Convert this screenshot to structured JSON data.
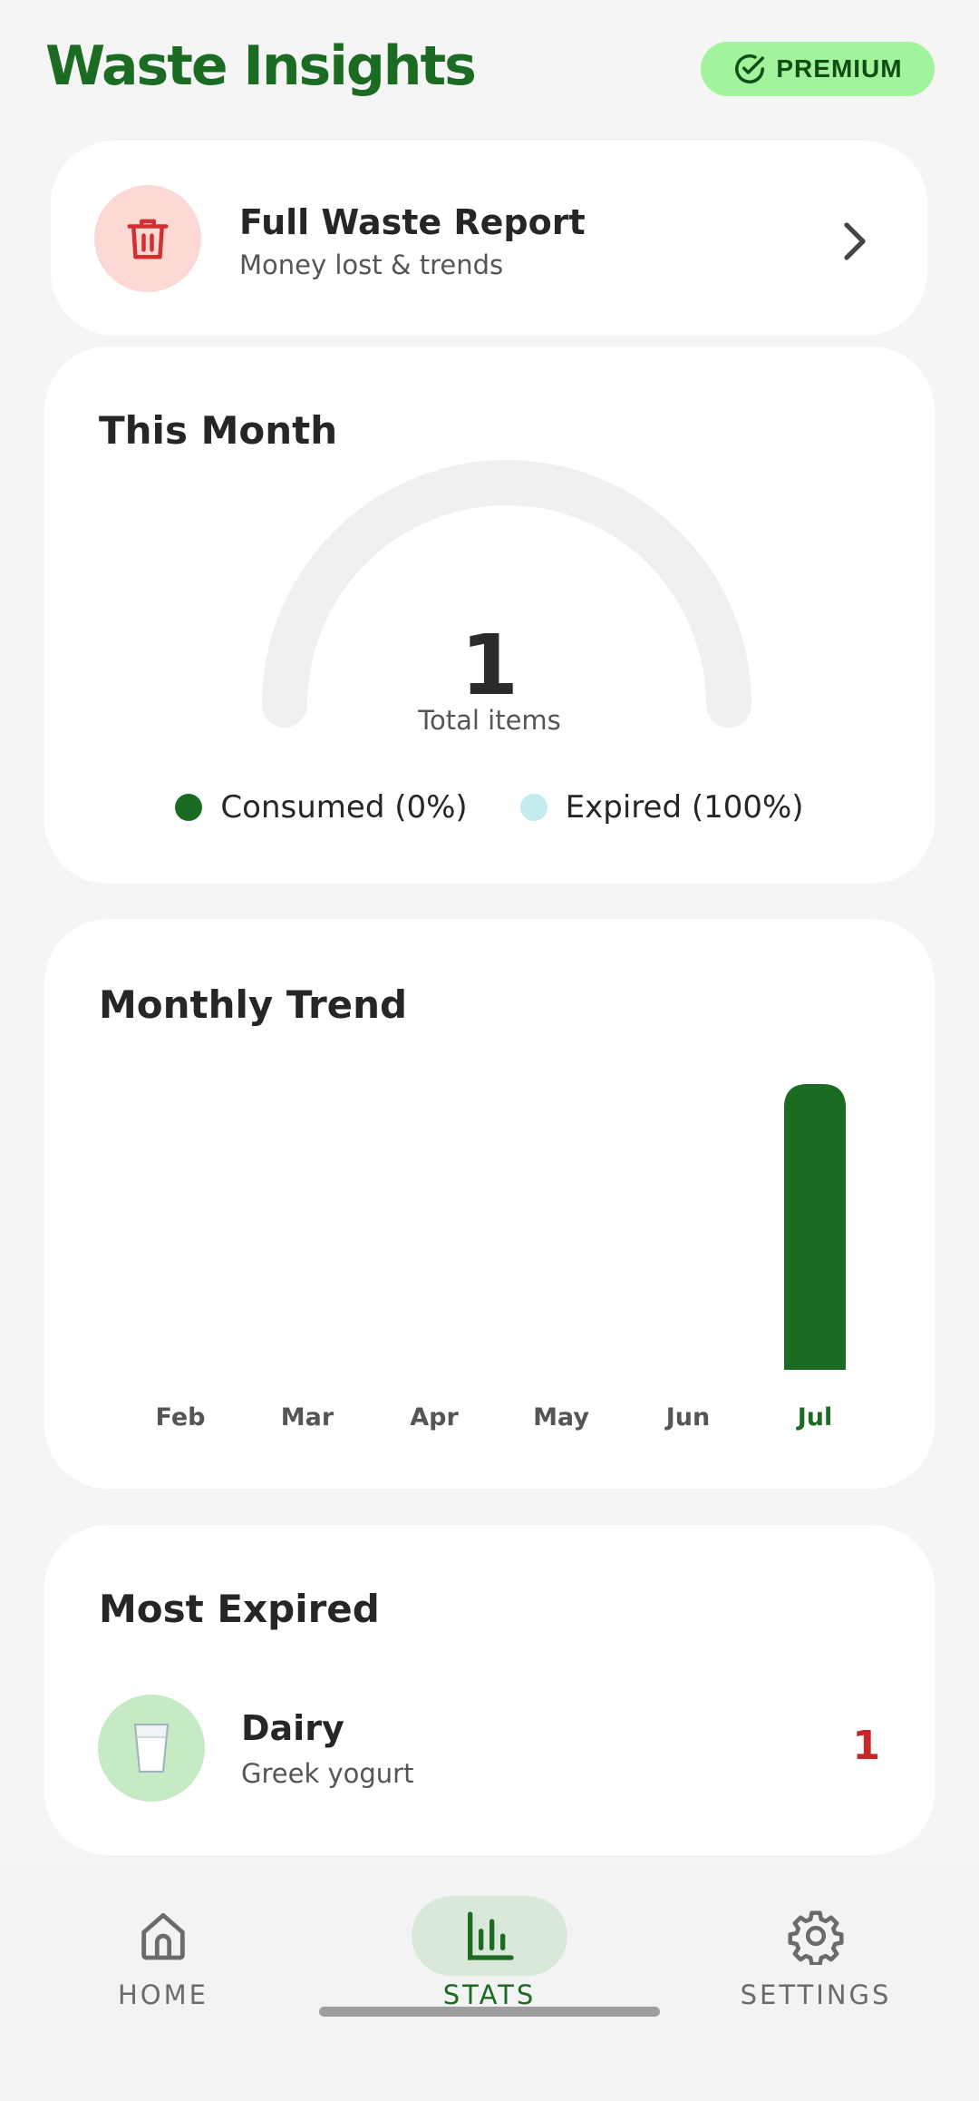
{
  "header": {
    "title": "Waste Insights",
    "badge": "PREMIUM"
  },
  "report_card": {
    "title": "Full Waste Report",
    "subtitle": "Money lost & trends",
    "icon": "trash-icon",
    "icon_color": "#d32f2f"
  },
  "this_month": {
    "heading": "This Month",
    "total": "1",
    "total_label": "Total items",
    "legend": [
      {
        "label": "Consumed (0%)",
        "color": "#1b6b23"
      },
      {
        "label": "Expired (100%)",
        "color": "#c3ecef"
      }
    ]
  },
  "monthly_trend": {
    "heading": "Monthly Trend"
  },
  "chart_data": {
    "type": "bar",
    "categories": [
      "Feb",
      "Mar",
      "Apr",
      "May",
      "Jun",
      "Jul"
    ],
    "values": [
      0,
      0,
      0,
      0,
      0,
      1
    ],
    "title": "Monthly Trend",
    "highlight_category": "Jul",
    "bar_color": "#1b6b23",
    "label_color": "#555555",
    "highlight_label_color": "#1b6b23"
  },
  "most_expired": {
    "heading": "Most Expired",
    "items": [
      {
        "name": "Dairy",
        "detail": "Greek yogurt",
        "count": "1",
        "icon": "milk-glass-icon"
      }
    ]
  },
  "nav": {
    "items": [
      {
        "label": "HOME",
        "icon": "home-icon",
        "active": false
      },
      {
        "label": "STATS",
        "icon": "bar-chart-icon",
        "active": true
      },
      {
        "label": "SETTINGS",
        "icon": "gear-icon",
        "active": false
      }
    ]
  },
  "colors": {
    "brand": "#1b6b23",
    "premium_bg": "#a1f39c",
    "danger": "#c62828"
  }
}
